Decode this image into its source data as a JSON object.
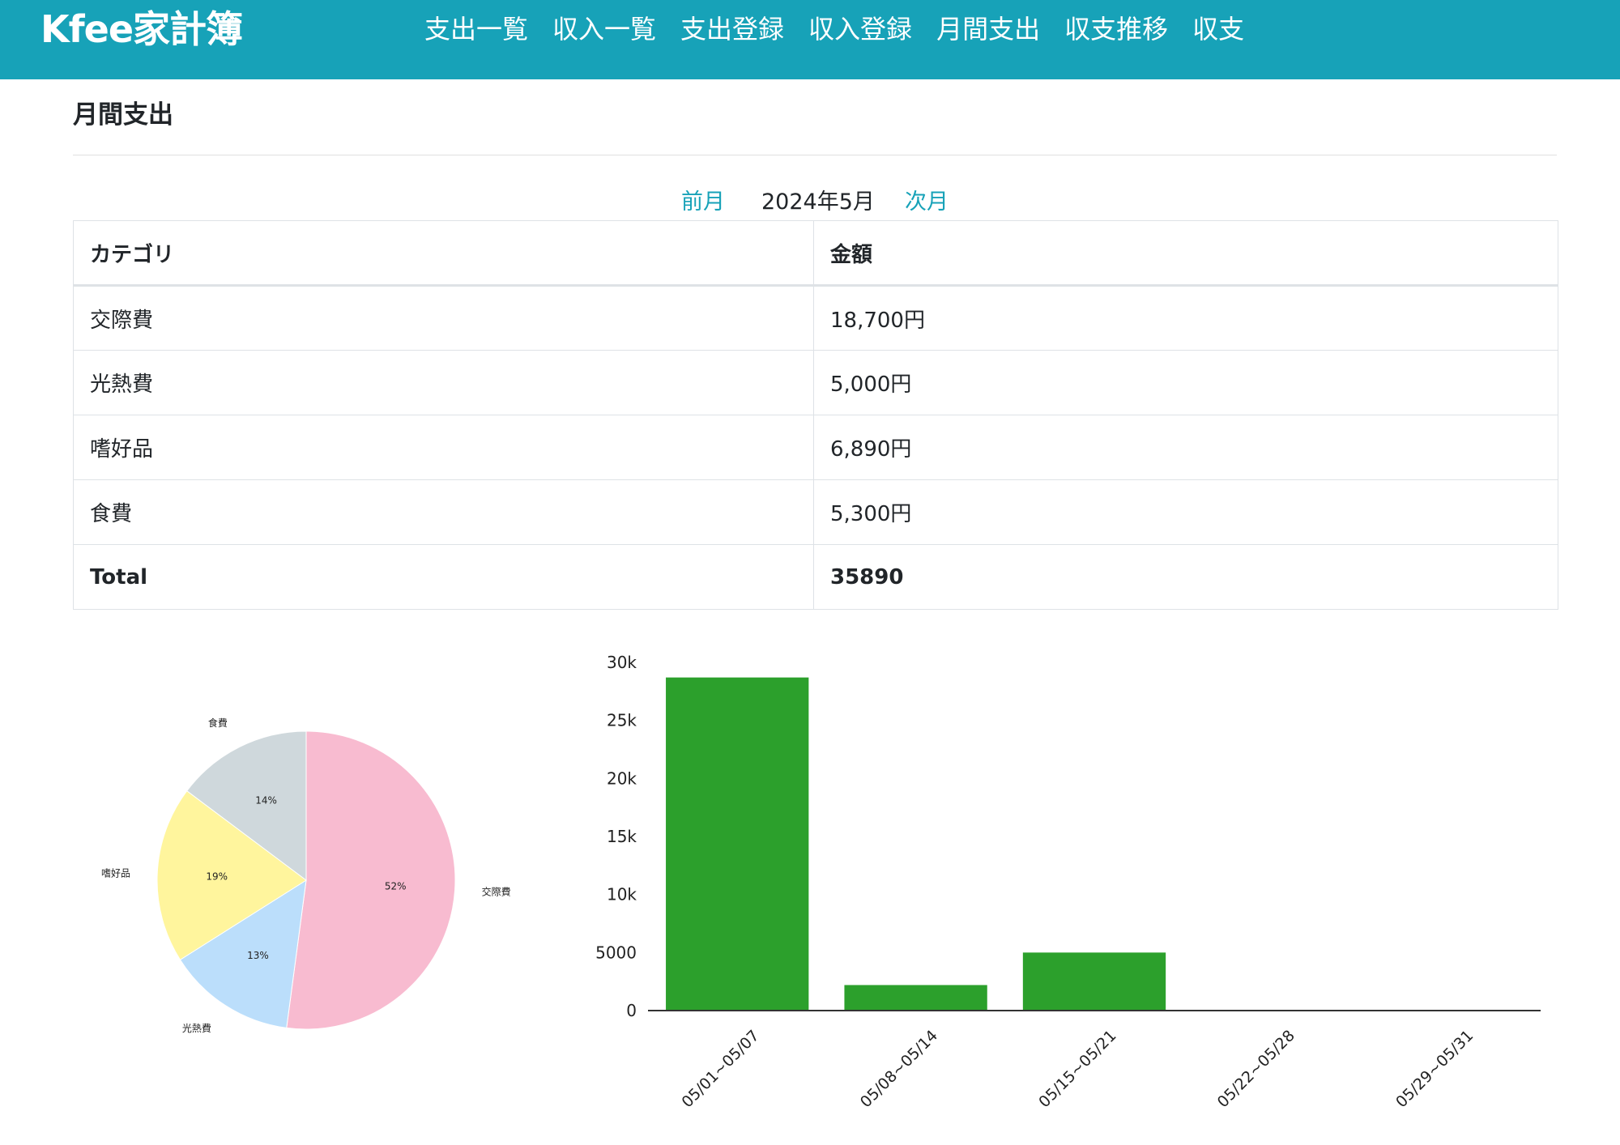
{
  "brand": "Kfee家計簿",
  "nav": [
    "支出一覧",
    "収入一覧",
    "支出登録",
    "収入登録",
    "月間支出",
    "収支推移",
    "収支"
  ],
  "page_title": "月間支出",
  "month_nav": {
    "prev": "前月",
    "current": "2024年5月",
    "next": "次月"
  },
  "table": {
    "headers": [
      "カテゴリ",
      "金額"
    ],
    "rows": [
      {
        "category": "交際費",
        "amount": "18,700円"
      },
      {
        "category": "光熱費",
        "amount": "5,000円"
      },
      {
        "category": "嗜好品",
        "amount": "6,890円"
      },
      {
        "category": "食費",
        "amount": "5,300円"
      }
    ],
    "total_label": "Total",
    "total_value": "35890"
  },
  "chart_data": [
    {
      "type": "pie",
      "labels": [
        "交際費",
        "光熱費",
        "嗜好品",
        "食費"
      ],
      "values": [
        18700,
        5000,
        6890,
        5300
      ],
      "percent_labels": [
        "52%",
        "13%",
        "19%",
        "14%"
      ],
      "colors": [
        "#f8bbd0",
        "#bbdefb",
        "#fff59d",
        "#cfd8dc"
      ]
    },
    {
      "type": "bar",
      "categories": [
        "05/01~05/07",
        "05/08~05/14",
        "05/15~05/21",
        "05/22~05/28",
        "05/29~05/31"
      ],
      "values": [
        28700,
        2200,
        5000,
        0,
        0
      ],
      "ylim": [
        0,
        30000
      ],
      "ytick_labels": [
        "0",
        "5000",
        "10k",
        "15k",
        "20k",
        "25k",
        "30k"
      ],
      "ytick_values": [
        0,
        5000,
        10000,
        15000,
        20000,
        25000,
        30000
      ],
      "color": "#2ca02c",
      "grid": false
    }
  ]
}
